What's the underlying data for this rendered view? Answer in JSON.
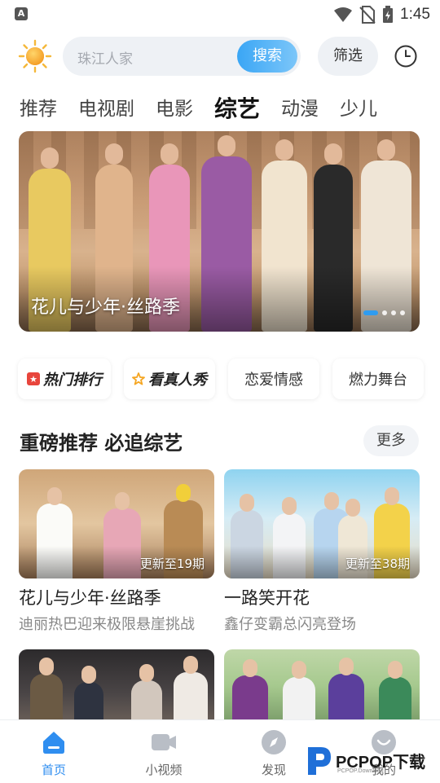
{
  "status_bar": {
    "time": "1:45",
    "notification_glyph": "A"
  },
  "header": {
    "weather_icon": "sun-icon",
    "search": {
      "placeholder": "珠江人家",
      "button_label": "搜索"
    },
    "filter_label": "筛选",
    "history_icon": "clock-icon"
  },
  "tabs": [
    {
      "label": "推荐",
      "active": false
    },
    {
      "label": "电视剧",
      "active": false
    },
    {
      "label": "电影",
      "active": false
    },
    {
      "label": "综艺",
      "active": true
    },
    {
      "label": "动漫",
      "active": false
    },
    {
      "label": "少儿",
      "active": false
    }
  ],
  "banner": {
    "title": "花儿与少年·丝路季",
    "pages": 4,
    "current_page": 1
  },
  "chips": [
    {
      "label": "热门排行",
      "icon": "bookmark-icon",
      "icon_color": "#e8453c"
    },
    {
      "label": "看真人秀",
      "icon": "star-icon",
      "icon_color": "#f5a623"
    },
    {
      "label": "恋爱情感"
    },
    {
      "label": "燃力舞台"
    }
  ],
  "section": {
    "title": "重磅推荐 必追综艺",
    "more_label": "更多"
  },
  "cards": [
    {
      "title": "花儿与少年·丝路季",
      "subtitle": "迪丽热巴迎来极限悬崖挑战",
      "badge": "更新至19期"
    },
    {
      "title": "一路笑开花",
      "subtitle": "鑫仔变霸总闪亮登场",
      "badge": "更新至38期"
    },
    {
      "title": "",
      "subtitle": "",
      "badge": ""
    },
    {
      "title": "",
      "subtitle": "",
      "badge": ""
    }
  ],
  "bottom_nav": [
    {
      "label": "首页",
      "icon": "home-icon",
      "active": true
    },
    {
      "label": "小视频",
      "icon": "video-icon",
      "active": false
    },
    {
      "label": "发现",
      "icon": "compass-icon",
      "active": false
    },
    {
      "label": "我的",
      "icon": "profile-icon",
      "active": false
    }
  ],
  "watermark": {
    "text": "PCPOP下载",
    "sub": "PCPOP.Download"
  },
  "colors": {
    "accent": "#2f8ef0",
    "search_button": "#3aa6f5",
    "chip_hot": "#e8453c",
    "chip_star": "#f5a623"
  }
}
